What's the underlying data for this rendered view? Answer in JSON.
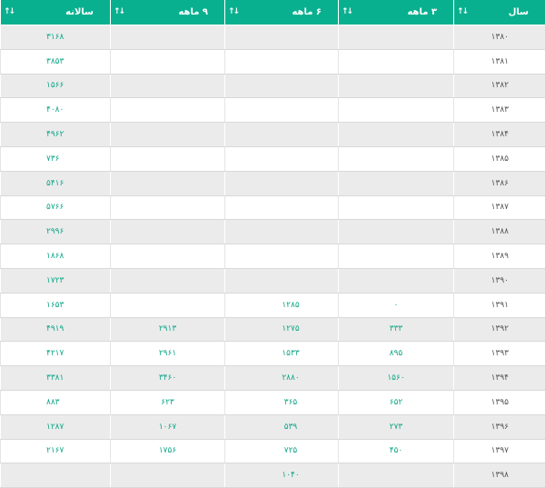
{
  "columns": [
    {
      "key": "year",
      "label": "سال"
    },
    {
      "key": "m3",
      "label": "۳ ماهه"
    },
    {
      "key": "m6",
      "label": "۶ ماهه"
    },
    {
      "key": "m9",
      "label": "۹ ماهه"
    },
    {
      "key": "annual",
      "label": "سالانه"
    }
  ],
  "sort_icon": "sort-arrows-icon",
  "colors": {
    "header_bg": "#09b08f",
    "value_text": "#13a789",
    "year_text": "#555555",
    "row_alt_bg": "#ebebeb"
  },
  "rows": [
    {
      "year": "۱۳۸۰",
      "m3": "",
      "m6": "",
      "m9": "",
      "annual": "۳۱۶۸"
    },
    {
      "year": "۱۳۸۱",
      "m3": "",
      "m6": "",
      "m9": "",
      "annual": "۳۸۵۳"
    },
    {
      "year": "۱۳۸۲",
      "m3": "",
      "m6": "",
      "m9": "",
      "annual": "۱۵۶۶"
    },
    {
      "year": "۱۳۸۳",
      "m3": "",
      "m6": "",
      "m9": "",
      "annual": "۴۰۸۰"
    },
    {
      "year": "۱۳۸۴",
      "m3": "",
      "m6": "",
      "m9": "",
      "annual": "۴۹۶۲"
    },
    {
      "year": "۱۳۸۵",
      "m3": "",
      "m6": "",
      "m9": "",
      "annual": "۷۳۶"
    },
    {
      "year": "۱۳۸۶",
      "m3": "",
      "m6": "",
      "m9": "",
      "annual": "۵۴۱۶"
    },
    {
      "year": "۱۳۸۷",
      "m3": "",
      "m6": "",
      "m9": "",
      "annual": "۵۷۶۶"
    },
    {
      "year": "۱۳۸۸",
      "m3": "",
      "m6": "",
      "m9": "",
      "annual": "۲۹۹۶"
    },
    {
      "year": "۱۳۸۹",
      "m3": "",
      "m6": "",
      "m9": "",
      "annual": "۱۸۶۸"
    },
    {
      "year": "۱۳۹۰",
      "m3": "",
      "m6": "",
      "m9": "",
      "annual": "۱۷۲۳"
    },
    {
      "year": "۱۳۹۱",
      "m3": "۰",
      "m6": "۱۲۸۵",
      "m9": "",
      "annual": "۱۶۵۳"
    },
    {
      "year": "۱۳۹۲",
      "m3": "۳۳۳",
      "m6": "۱۲۷۵",
      "m9": "۲۹۱۳",
      "annual": "۴۹۱۹"
    },
    {
      "year": "۱۳۹۳",
      "m3": "۸۹۵",
      "m6": "۱۵۳۳",
      "m9": "۲۹۶۱",
      "annual": "۴۲۱۷"
    },
    {
      "year": "۱۳۹۴",
      "m3": "۱۵۶۰",
      "m6": "۲۸۸۰",
      "m9": "۳۴۶۰",
      "annual": "۳۳۸۱"
    },
    {
      "year": "۱۳۹۵",
      "m3": "۶۵۲",
      "m6": "۳۶۵",
      "m9": "۶۲۳",
      "annual": "۸۸۳"
    },
    {
      "year": "۱۳۹۶",
      "m3": "۲۷۳",
      "m6": "۵۳۹",
      "m9": "۱۰۶۷",
      "annual": "۱۲۸۷"
    },
    {
      "year": "۱۳۹۷",
      "m3": "۴۵۰",
      "m6": "۷۲۵",
      "m9": "۱۷۵۶",
      "annual": "۲۱۶۷"
    },
    {
      "year": "۱۳۹۸",
      "m3": "",
      "m6": "۱۰۴۰",
      "m9": "",
      "annual": ""
    }
  ]
}
